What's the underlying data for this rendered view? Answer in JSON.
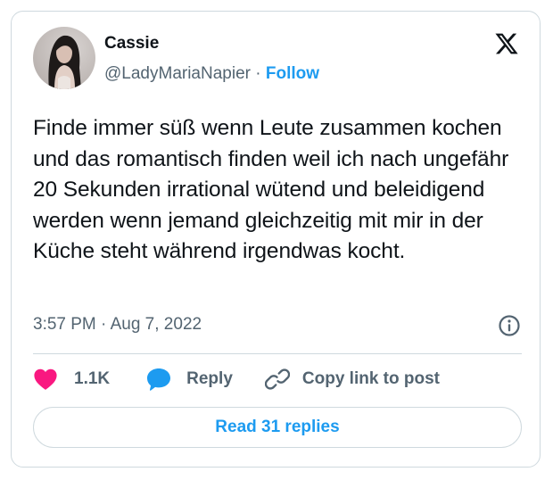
{
  "tweet": {
    "author": {
      "name": "Cassie",
      "handle": "@LadyMariaNapier",
      "separator": "·",
      "follow_label": "Follow",
      "avatar": "profile-photo"
    },
    "brand_icon": "x-logo-icon",
    "text": "Finde immer süß wenn Leute zusammen kochen und das romantisch finden weil ich nach ungefähr 20 Sekunden irrational wütend und beleidigend werden wenn jemand gleichzeitig mit mir in der Küche steht während irgendwas kocht.",
    "timestamp": "3:57 PM · Aug 7, 2022",
    "info_icon": "info-icon",
    "actions": {
      "like_count": "1.1K",
      "reply_label": "Reply",
      "copy_link_label": "Copy link to post"
    },
    "read_replies_label": "Read 31 replies"
  },
  "colors": {
    "accent": "#1d9bf0",
    "like": "#f91880",
    "secondary_text": "#536471",
    "primary_text": "#0f1419",
    "border": "#cfd9de"
  }
}
